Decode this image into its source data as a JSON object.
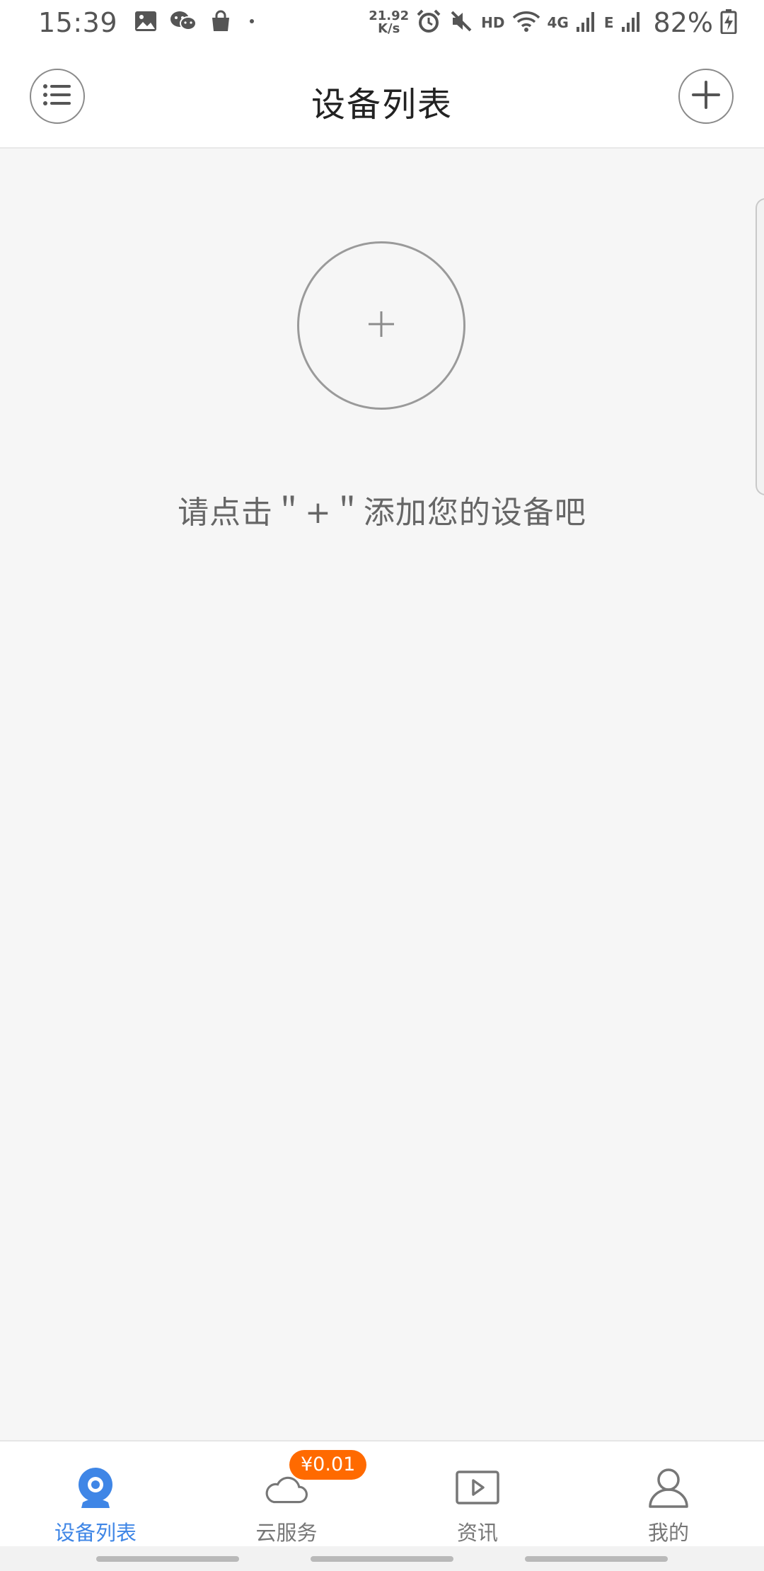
{
  "status_bar": {
    "time": "15:39",
    "network_speed_value": "21.92",
    "network_speed_unit": "K/s",
    "hd_label": "HD",
    "signal_4g_label": "4G",
    "signal_e_label": "E",
    "battery": "82%",
    "icons": [
      "image-icon",
      "wechat-icon",
      "shopping-bag-icon",
      "dot-icon",
      "alarm-icon",
      "mute-icon",
      "wifi-icon",
      "cellular-signal-icon",
      "battery-charging-icon"
    ]
  },
  "header": {
    "title": "设备列表",
    "left_button_icon": "list-menu-icon",
    "right_button_icon": "plus-icon"
  },
  "empty_state": {
    "add_icon": "plus-icon",
    "hint": "请点击＂+＂添加您的设备吧"
  },
  "bottom_nav": {
    "active_color": "#3f86e6",
    "items": [
      {
        "label": "设备列表",
        "icon": "camera-icon",
        "active": true
      },
      {
        "label": "云服务",
        "icon": "cloud-icon",
        "badge": "¥0.01"
      },
      {
        "label": "资讯",
        "icon": "video-play-icon"
      },
      {
        "label": "我的",
        "icon": "user-icon"
      }
    ]
  },
  "colors": {
    "badge": "#ff6a00",
    "background": "#f6f6f6"
  }
}
